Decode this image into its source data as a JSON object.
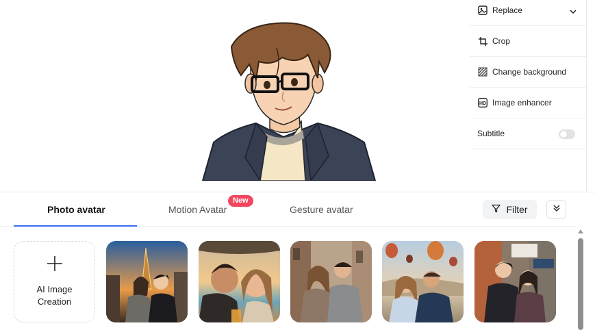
{
  "properties": {
    "replace": "Replace",
    "crop": "Crop",
    "change_background": "Change background",
    "image_enhancer": "Image enhancer",
    "subtitle": "Subtitle"
  },
  "tabs": {
    "photo_avatar": "Photo avatar",
    "motion_avatar": "Motion Avatar",
    "gesture_avatar": "Gesture avatar",
    "new_badge": "New"
  },
  "toolbar": {
    "filter_label": "Filter"
  },
  "ai_card": {
    "label": "AI Image Creation"
  },
  "photos": [
    {
      "description_icon": "couple-paris-photo"
    },
    {
      "description_icon": "couple-sunset-photo"
    },
    {
      "description_icon": "couple-street-photo"
    },
    {
      "description_icon": "couple-balloons-photo"
    },
    {
      "description_icon": "couple-city-photo"
    }
  ],
  "colors": {
    "accent": "#3a6df0",
    "badge": "#f4465e"
  }
}
